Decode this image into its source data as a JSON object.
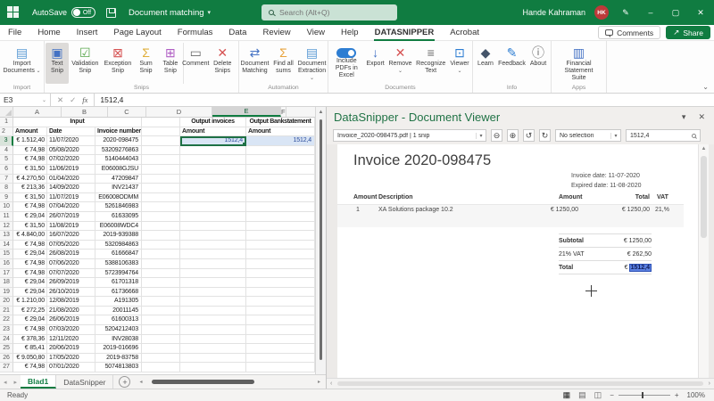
{
  "icons": {
    "chevron_down": "⌄",
    "dropdown_arrow": "▾",
    "close": "✕",
    "minimize": "–",
    "maximize": "▢",
    "pen": "✎",
    "cancel": "✕",
    "confirm": "✓",
    "fx": "fx",
    "up_arrow": "▲",
    "nav_left": "◂",
    "nav_right": "▸",
    "small_left": "‹",
    "small_right": "›",
    "add": "+",
    "zoom_out": "⊖",
    "zoom_in": "⊕",
    "rotate_ccw": "↺",
    "rotate_cw": "↻",
    "minus": "−",
    "plus": "+",
    "share_arrow": "↗",
    "view_normal": "▦",
    "view_layout": "▤",
    "view_break": "◫"
  },
  "colors": {
    "excel_green": "#107C41",
    "datasnipper_green": "#217346",
    "snip_cell_fill": "#d9e5f5",
    "snip_text": "#2a4b9b",
    "snip_highlight": "#5b80e0",
    "avatar_red": "#bd3a3a"
  },
  "titlebar": {
    "autosave_label": "AutoSave",
    "autosave_state": "Off",
    "doc_title": "Document matching",
    "search_placeholder": "Search (Alt+Q)",
    "user_name": "Hande Kahraman",
    "user_initials": "HK"
  },
  "menu": {
    "tabs": [
      {
        "label": "File"
      },
      {
        "label": "Home"
      },
      {
        "label": "Insert"
      },
      {
        "label": "Page Layout"
      },
      {
        "label": "Formulas"
      },
      {
        "label": "Data"
      },
      {
        "label": "Review"
      },
      {
        "label": "View"
      },
      {
        "label": "Help"
      },
      {
        "label": "DATASNIPPER",
        "active": true
      },
      {
        "label": "Acrobat"
      }
    ],
    "comments_label": "Comments",
    "share_label": "Share"
  },
  "ribbon": {
    "groups": [
      {
        "label": "Import",
        "buttons": [
          {
            "label": "Import Documents",
            "icon": "import-documents-icon",
            "glyph": "▤",
            "color": "#5b9bd5",
            "dropdown": true
          }
        ]
      },
      {
        "label": "Snips",
        "buttons": [
          {
            "label": "Text Snip",
            "icon": "text-snip-icon",
            "glyph": "▣",
            "color": "#4472c4",
            "selected": true
          },
          {
            "label": "Validation Snip",
            "icon": "validation-snip-icon",
            "glyph": "☑",
            "color": "#57a64a"
          },
          {
            "label": "Exception Snip",
            "icon": "exception-snip-icon",
            "glyph": "⊠",
            "color": "#d65353"
          },
          {
            "label": "Sum Snip",
            "icon": "sum-snip-icon",
            "glyph": "Σ",
            "color": "#dfae3a"
          },
          {
            "label": "Table Snip",
            "icon": "table-snip-icon",
            "glyph": "⊞",
            "color": "#b05ec4"
          },
          {
            "label": "Comment",
            "icon": "comment-icon",
            "glyph": "▭",
            "color": "#6a6a6a"
          },
          {
            "label": "Delete Snips",
            "icon": "delete-snips-icon",
            "glyph": "✕",
            "color": "#d65353"
          }
        ]
      },
      {
        "label": "Automation",
        "buttons": [
          {
            "label": "Document Matching",
            "icon": "document-matching-icon",
            "glyph": "⇄",
            "color": "#4472c4"
          },
          {
            "label": "Find all sums",
            "icon": "find-all-sums-icon",
            "glyph": "Σ",
            "color": "#e8a33d"
          },
          {
            "label": "Document Extraction",
            "icon": "document-extraction-icon",
            "glyph": "▤",
            "color": "#5b9bd5",
            "dropdown": true
          }
        ]
      },
      {
        "label": "Documents",
        "buttons": [
          {
            "label": "Include PDFs in Excel",
            "icon": "include-pdfs-toggle-icon",
            "glyph": "",
            "color": "#2d7dd2"
          },
          {
            "label": "Export",
            "icon": "export-icon",
            "glyph": "↓",
            "color": "#4472c4"
          },
          {
            "label": "Remove",
            "icon": "remove-document-icon",
            "glyph": "✕",
            "color": "#d65353",
            "dropdown": true
          },
          {
            "label": "Recognize Text",
            "icon": "recognize-text-icon",
            "glyph": "≡",
            "color": "#6a6a6a"
          },
          {
            "label": "Viewer",
            "icon": "viewer-icon",
            "glyph": "⊡",
            "color": "#2d7dd2",
            "dropdown": true
          }
        ]
      },
      {
        "label": "Info",
        "buttons": [
          {
            "label": "Learn",
            "icon": "learn-icon",
            "glyph": "◆",
            "color": "#44546a"
          },
          {
            "label": "Feedback",
            "icon": "feedback-icon",
            "glyph": "✎",
            "color": "#2d7dd2"
          },
          {
            "label": "About",
            "icon": "about-icon",
            "glyph": "ⓘ",
            "color": "#6a6a6a"
          }
        ]
      },
      {
        "label": "Apps",
        "buttons": [
          {
            "label": "Financial Statement Suite",
            "icon": "financial-statement-suite-icon",
            "glyph": "▥",
            "color": "#4472c4"
          }
        ]
      }
    ]
  },
  "sheet": {
    "name_box": "E3",
    "formula": "1512,4",
    "columns": [
      {
        "label": "A"
      },
      {
        "label": "B"
      },
      {
        "label": "C"
      },
      {
        "label": "D"
      },
      {
        "label": "E",
        "sel": true
      },
      {
        "label": "F"
      }
    ],
    "header1": {
      "num": "1",
      "input": "Input",
      "e": "Output invoices",
      "f": "Output Bankstatement"
    },
    "header2": {
      "num": "2",
      "a": "Amount",
      "b": "Date",
      "c": "Invoice number",
      "e": "Amount",
      "f": "Amount"
    },
    "rows": [
      {
        "n": "3",
        "a": "€ 1.512,40",
        "b": "11/07/2020",
        "c": "2020-098475",
        "e": "1512,4",
        "f": "1512,4",
        "snip": true
      },
      {
        "n": "4",
        "a": "€ 74,98",
        "b": "05/08/2020",
        "c": "53209276863"
      },
      {
        "n": "5",
        "a": "€ 74,98",
        "b": "07/02/2020",
        "c": "5140444043"
      },
      {
        "n": "6",
        "a": "€ 31,50",
        "b": "11/06/2019",
        "c": "E06008GJSU"
      },
      {
        "n": "7",
        "a": "€ 4.270,50",
        "b": "01/04/2020",
        "c": "47209847"
      },
      {
        "n": "8",
        "a": "€ 213,36",
        "b": "14/09/2020",
        "c": "INV21437"
      },
      {
        "n": "9",
        "a": "€ 31,50",
        "b": "11/07/2019",
        "c": "E06008ODMM"
      },
      {
        "n": "10",
        "a": "€ 74,98",
        "b": "07/04/2020",
        "c": "5261846983"
      },
      {
        "n": "11",
        "a": "€ 29,04",
        "b": "26/07/2019",
        "c": "61633095"
      },
      {
        "n": "12",
        "a": "€ 31,50",
        "b": "11/08/2019",
        "c": "E06008WDC4"
      },
      {
        "n": "13",
        "a": "€ 4.840,00",
        "b": "16/07/2020",
        "c": "2019-939388"
      },
      {
        "n": "14",
        "a": "€ 74,98",
        "b": "07/05/2020",
        "c": "5320984863"
      },
      {
        "n": "15",
        "a": "€ 29,04",
        "b": "26/08/2019",
        "c": "61666847"
      },
      {
        "n": "16",
        "a": "€ 74,98",
        "b": "07/06/2020",
        "c": "5388106383"
      },
      {
        "n": "17",
        "a": "€ 74,98",
        "b": "07/07/2020",
        "c": "5723994764"
      },
      {
        "n": "18",
        "a": "€ 29,04",
        "b": "26/09/2019",
        "c": "61701318"
      },
      {
        "n": "19",
        "a": "€ 29,04",
        "b": "26/10/2019",
        "c": "61736668"
      },
      {
        "n": "20",
        "a": "€ 1.210,00",
        "b": "12/08/2019",
        "c": "A191305"
      },
      {
        "n": "21",
        "a": "€ 272,25",
        "b": "21/08/2020",
        "c": "20011145"
      },
      {
        "n": "22",
        "a": "€ 29,04",
        "b": "26/06/2019",
        "c": "61600313"
      },
      {
        "n": "23",
        "a": "€ 74,98",
        "b": "07/03/2020",
        "c": "5204212403"
      },
      {
        "n": "24",
        "a": "€ 378,36",
        "b": "12/11/2020",
        "c": "INV28038"
      },
      {
        "n": "25",
        "a": "€ 85,41",
        "b": "20/06/2019",
        "c": "2019-016696"
      },
      {
        "n": "26",
        "a": "€ 9.050,80",
        "b": "17/05/2020",
        "c": "2019-83758"
      },
      {
        "n": "27",
        "a": "€ 74,98",
        "b": "07/01/2020",
        "c": "5074813803"
      }
    ],
    "tabs": [
      {
        "label": "Blad1",
        "active": true
      },
      {
        "label": "DataSnipper"
      }
    ],
    "status": "Ready",
    "zoom": "100%"
  },
  "panel": {
    "title": "DataSnipper - Document Viewer",
    "file_dropdown": "Invoice_2020-098475.pdf | 1 snip",
    "selection_dropdown": "No selection",
    "search_value": "1512,4",
    "invoice": {
      "title": "Invoice 2020-098475",
      "invoice_date": "Invoice date: 11-07-2020",
      "expired_date": "Expired date: 11-08-2020",
      "table": {
        "headers": {
          "qty": "Amount",
          "desc": "Description",
          "amount": "Amount",
          "total": "Total",
          "vat": "VAT"
        },
        "rows": [
          {
            "qty": "1",
            "desc": "XA Solutions package 10.2",
            "amount": "€ 1250,00",
            "total": "€ 1250,00",
            "vat": "21,%"
          }
        ]
      },
      "totals": [
        {
          "label": "Subtotal",
          "value": "€ 1250,00",
          "bold": true
        },
        {
          "label": "21% VAT",
          "value": "€ 262,50"
        },
        {
          "label": "Total",
          "value": "€",
          "highlight": "1512,4",
          "bold": true
        }
      ]
    }
  }
}
